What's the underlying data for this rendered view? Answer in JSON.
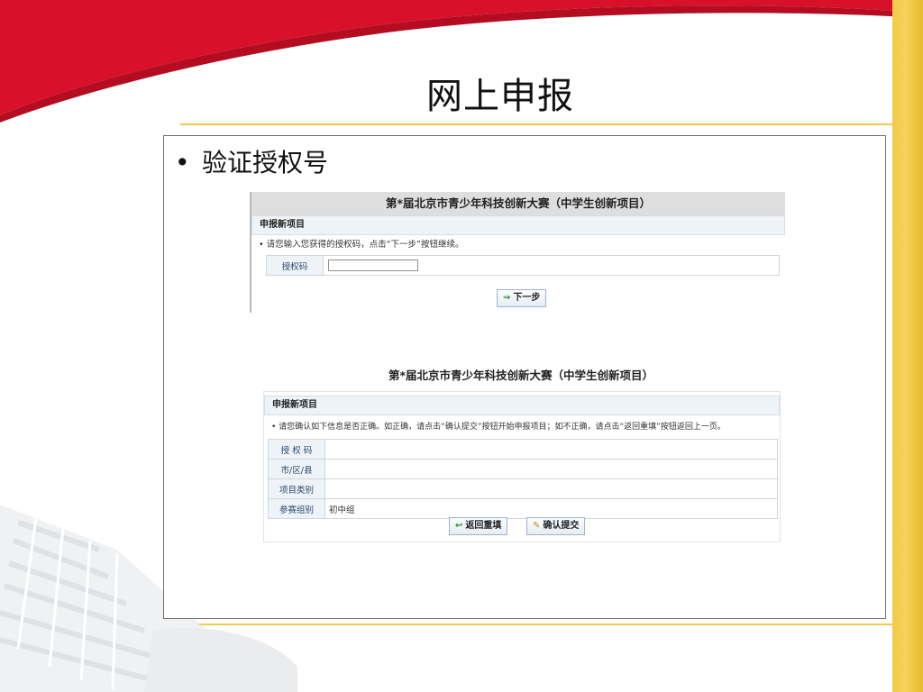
{
  "slide": {
    "title": "网上申报",
    "bullet": "验证授权号"
  },
  "screen1": {
    "title": "第*届北京市青少年科技创新大赛（中学生创新项目）",
    "section": "申报新项目",
    "note": "• 请您输入您获得的授权码，点击“下一步”按钮继续。",
    "field_label": "授权码",
    "field_value": "",
    "next_button": "下一步"
  },
  "screen2": {
    "title": "第*届北京市青少年科技创新大赛（中学生创新项目）",
    "section": "申报新项目",
    "note": "• 请您确认如下信息是否正确。如正确，请点击“确认提交”按钮开始申报项目；如不正确，请点击“返回重填”按钮返回上一页。",
    "rows": [
      {
        "label": "授 权 码",
        "value": ""
      },
      {
        "label": "市/区/县",
        "value": ""
      },
      {
        "label": "项目类别",
        "value": ""
      },
      {
        "label": "参赛组别",
        "value": "初中组"
      }
    ],
    "back_button": "返回重填",
    "confirm_button": "确认提交"
  },
  "colors": {
    "red_swoosh": "#d8102a",
    "gold": "#f2c94a",
    "header_gray": "#dedede",
    "section_blue": "#eef3f7"
  },
  "icons": {
    "next": "arrow-right-icon",
    "back": "return-arrow-icon",
    "confirm": "pencil-icon"
  }
}
